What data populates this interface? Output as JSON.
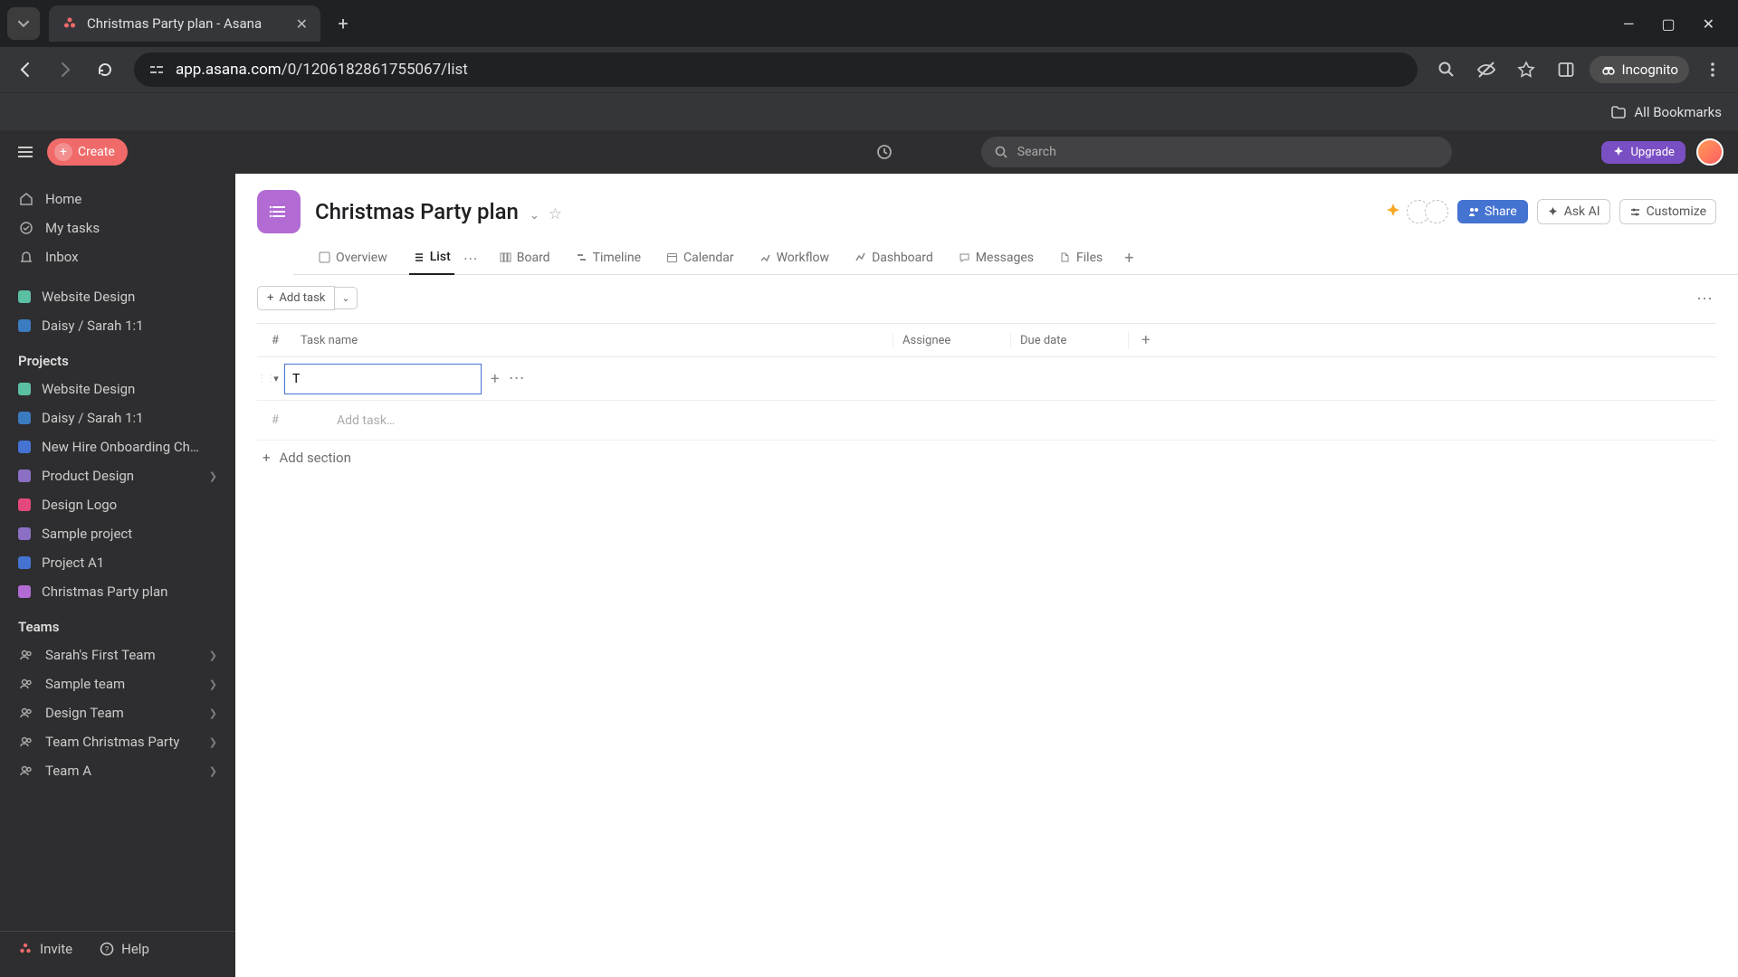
{
  "browser": {
    "tab_title": "Christmas Party plan - Asana",
    "url_domain": "app.asana.com",
    "url_path": "/0/1206182861755067/list",
    "incognito_label": "Incognito",
    "all_bookmarks": "All Bookmarks"
  },
  "app_header": {
    "create": "Create",
    "search_placeholder": "Search",
    "upgrade": "Upgrade"
  },
  "sidebar": {
    "nav": [
      {
        "label": "Home",
        "icon": "home"
      },
      {
        "label": "My tasks",
        "icon": "check"
      },
      {
        "label": "Inbox",
        "icon": "bell"
      }
    ],
    "starred": [
      {
        "label": "Website Design",
        "color": "#5bbfa3"
      },
      {
        "label": "Daisy / Sarah 1:1",
        "color": "#3b7bbf"
      }
    ],
    "projects_label": "Projects",
    "projects": [
      {
        "label": "Website Design",
        "color": "#5bbfa3",
        "chev": false
      },
      {
        "label": "Daisy / Sarah 1:1",
        "color": "#3b7bbf",
        "chev": false
      },
      {
        "label": "New Hire Onboarding Ch…",
        "color": "#4573d2",
        "chev": false
      },
      {
        "label": "Product Design",
        "color": "#8b6fc4",
        "chev": true
      },
      {
        "label": "Design Logo",
        "color": "#e5487a",
        "chev": false
      },
      {
        "label": "Sample project",
        "color": "#8b6fc4",
        "chev": false
      },
      {
        "label": "Project A1",
        "color": "#4573d2",
        "chev": false
      },
      {
        "label": "Christmas Party plan",
        "color": "#b36bd4",
        "chev": false
      }
    ],
    "teams_label": "Teams",
    "teams": [
      {
        "label": "Sarah's First Team"
      },
      {
        "label": "Sample team"
      },
      {
        "label": "Design Team"
      },
      {
        "label": "Team Christmas Party"
      },
      {
        "label": "Team A"
      }
    ],
    "invite": "Invite",
    "help": "Help"
  },
  "project": {
    "title": "Christmas Party plan",
    "share": "Share",
    "ask_ai": "Ask AI",
    "customize": "Customize",
    "tabs": [
      {
        "label": "Overview"
      },
      {
        "label": "List",
        "active": true
      },
      {
        "label": "Board"
      },
      {
        "label": "Timeline"
      },
      {
        "label": "Calendar"
      },
      {
        "label": "Workflow"
      },
      {
        "label": "Dashboard"
      },
      {
        "label": "Messages"
      },
      {
        "label": "Files"
      }
    ],
    "add_task": "Add task",
    "columns": {
      "num": "#",
      "name": "Task name",
      "assignee": "Assignee",
      "due": "Due date"
    },
    "section_input_value": "T",
    "add_task_placeholder": "Add task…",
    "add_section": "Add section",
    "hash": "#"
  }
}
